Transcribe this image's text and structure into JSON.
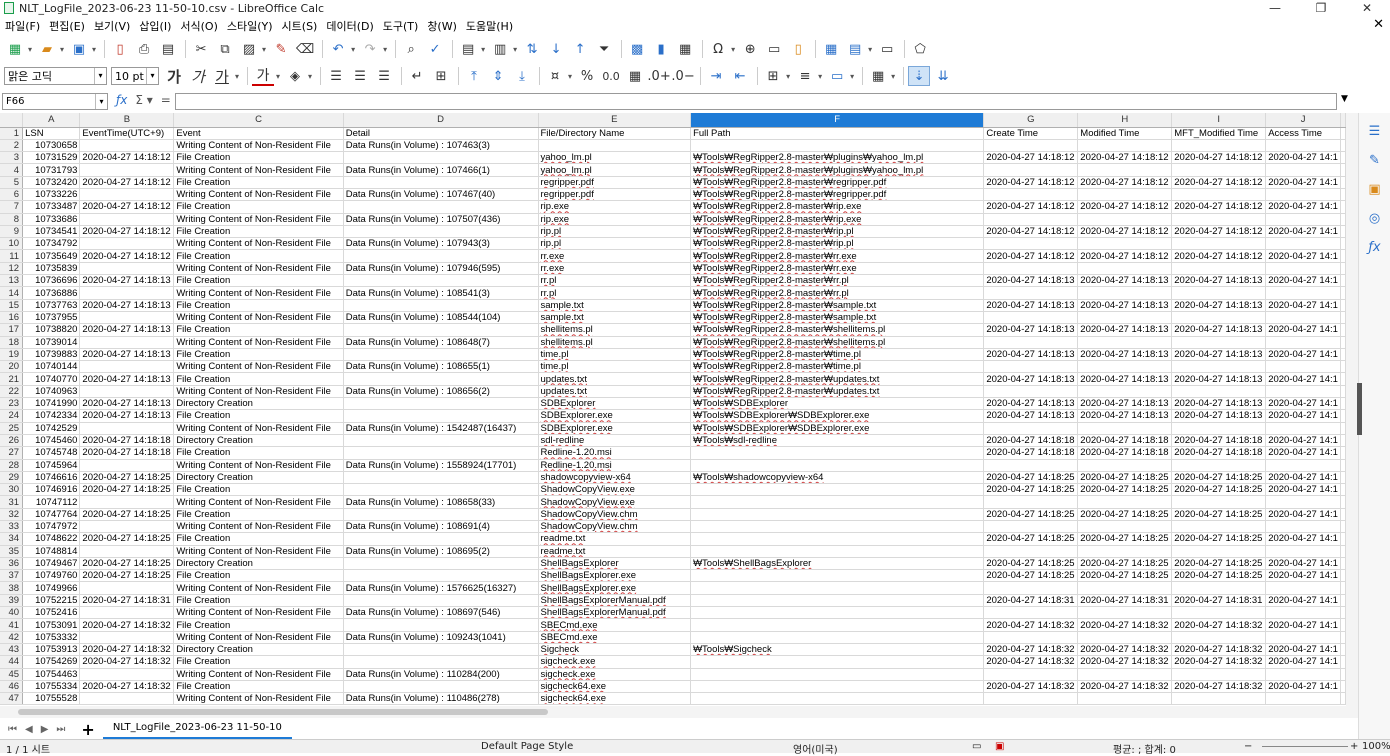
{
  "window": {
    "title": "NLT_LogFile_2023-06-23 11-50-10.csv - LibreOffice Calc",
    "buttons": [
      "—",
      "❐",
      "✕"
    ]
  },
  "menu": [
    "파일(F)",
    "편집(E)",
    "보기(V)",
    "삽입(I)",
    "서식(O)",
    "스타일(Y)",
    "시트(S)",
    "데이터(D)",
    "도구(T)",
    "창(W)",
    "도움말(H)"
  ],
  "format_bar": {
    "font_name": "맑은 고딕",
    "font_size": "10 pt",
    "bold_glyph": "가",
    "italic_glyph": "가",
    "underline_glyph": "가",
    "fontcolor_glyph": "가",
    "percent": "%",
    "number_format": "0.0"
  },
  "formula_bar": {
    "cell_ref": "F66",
    "content": ""
  },
  "columns": [
    "A",
    "B",
    "C",
    "D",
    "E",
    "F",
    "G",
    "H",
    "I",
    "J"
  ],
  "selected_column": "F",
  "header_row": [
    "LSN",
    "EventTime(UTC+9)",
    "Event",
    "Detail",
    "File/Directory Name",
    "Full Path",
    "Create Time",
    "Modified Time",
    "MFT_Modified Time",
    "Access Time"
  ],
  "rows": [
    [
      "10730658",
      "",
      "Writing Content of Non-Resident File",
      "Data Runs(in Volume) : 107463(3)",
      "",
      "",
      "",
      "",
      "",
      ""
    ],
    [
      "10731529",
      "2020-04-27 14:18:12",
      "File Creation",
      "",
      "yahoo_lm.pl",
      "₩Tools₩RegRipper2.8-master₩plugins₩yahoo_lm.pl",
      "2020-04-27 14:18:12",
      "2020-04-27 14:18:12",
      "2020-04-27 14:18:12",
      "2020-04-27 14:1"
    ],
    [
      "10731793",
      "",
      "Writing Content of Non-Resident File",
      "Data Runs(in Volume) : 107466(1)",
      "yahoo_lm.pl",
      "₩Tools₩RegRipper2.8-master₩plugins₩yahoo_lm.pl",
      "",
      "",
      "",
      ""
    ],
    [
      "10732420",
      "2020-04-27 14:18:12",
      "File Creation",
      "",
      "regripper.pdf",
      "₩Tools₩RegRipper2.8-master₩regripper.pdf",
      "2020-04-27 14:18:12",
      "2020-04-27 14:18:12",
      "2020-04-27 14:18:12",
      "2020-04-27 14:1"
    ],
    [
      "10733226",
      "",
      "Writing Content of Non-Resident File",
      "Data Runs(in Volume) : 107467(40)",
      "regripper.pdf",
      "₩Tools₩RegRipper2.8-master₩regripper.pdf",
      "",
      "",
      "",
      ""
    ],
    [
      "10733487",
      "2020-04-27 14:18:12",
      "File Creation",
      "",
      "rip.exe",
      "₩Tools₩RegRipper2.8-master₩rip.exe",
      "2020-04-27 14:18:12",
      "2020-04-27 14:18:12",
      "2020-04-27 14:18:12",
      "2020-04-27 14:1"
    ],
    [
      "10733686",
      "",
      "Writing Content of Non-Resident File",
      "Data Runs(in Volume) : 107507(436)",
      "rip.exe",
      "₩Tools₩RegRipper2.8-master₩rip.exe",
      "",
      "",
      "",
      ""
    ],
    [
      "10734541",
      "2020-04-27 14:18:12",
      "File Creation",
      "",
      "rip.pl",
      "₩Tools₩RegRipper2.8-master₩rip.pl",
      "2020-04-27 14:18:12",
      "2020-04-27 14:18:12",
      "2020-04-27 14:18:12",
      "2020-04-27 14:1"
    ],
    [
      "10734792",
      "",
      "Writing Content of Non-Resident File",
      "Data Runs(in Volume) : 107943(3)",
      "rip.pl",
      "₩Tools₩RegRipper2.8-master₩rip.pl",
      "",
      "",
      "",
      ""
    ],
    [
      "10735649",
      "2020-04-27 14:18:12",
      "File Creation",
      "",
      "rr.exe",
      "₩Tools₩RegRipper2.8-master₩rr.exe",
      "2020-04-27 14:18:12",
      "2020-04-27 14:18:12",
      "2020-04-27 14:18:12",
      "2020-04-27 14:1"
    ],
    [
      "10735839",
      "",
      "Writing Content of Non-Resident File",
      "Data Runs(in Volume) : 107946(595)",
      "rr.exe",
      "₩Tools₩RegRipper2.8-master₩rr.exe",
      "",
      "",
      "",
      ""
    ],
    [
      "10736696",
      "2020-04-27 14:18:13",
      "File Creation",
      "",
      "rr.pl",
      "₩Tools₩RegRipper2.8-master₩rr.pl",
      "2020-04-27 14:18:13",
      "2020-04-27 14:18:13",
      "2020-04-27 14:18:13",
      "2020-04-27 14:1"
    ],
    [
      "10736886",
      "",
      "Writing Content of Non-Resident File",
      "Data Runs(in Volume) : 108541(3)",
      "rr.pl",
      "₩Tools₩RegRipper2.8-master₩rr.pl",
      "",
      "",
      "",
      ""
    ],
    [
      "10737763",
      "2020-04-27 14:18:13",
      "File Creation",
      "",
      "sample.txt",
      "₩Tools₩RegRipper2.8-master₩sample.txt",
      "2020-04-27 14:18:13",
      "2020-04-27 14:18:13",
      "2020-04-27 14:18:13",
      "2020-04-27 14:1"
    ],
    [
      "10737955",
      "",
      "Writing Content of Non-Resident File",
      "Data Runs(in Volume) : 108544(104)",
      "sample.txt",
      "₩Tools₩RegRipper2.8-master₩sample.txt",
      "",
      "",
      "",
      ""
    ],
    [
      "10738820",
      "2020-04-27 14:18:13",
      "File Creation",
      "",
      "shellitems.pl",
      "₩Tools₩RegRipper2.8-master₩shellitems.pl",
      "2020-04-27 14:18:13",
      "2020-04-27 14:18:13",
      "2020-04-27 14:18:13",
      "2020-04-27 14:1"
    ],
    [
      "10739014",
      "",
      "Writing Content of Non-Resident File",
      "Data Runs(in Volume) : 108648(7)",
      "shellitems.pl",
      "₩Tools₩RegRipper2.8-master₩shellitems.pl",
      "",
      "",
      "",
      ""
    ],
    [
      "10739883",
      "2020-04-27 14:18:13",
      "File Creation",
      "",
      "time.pl",
      "₩Tools₩RegRipper2.8-master₩time.pl",
      "2020-04-27 14:18:13",
      "2020-04-27 14:18:13",
      "2020-04-27 14:18:13",
      "2020-04-27 14:1"
    ],
    [
      "10740144",
      "",
      "Writing Content of Non-Resident File",
      "Data Runs(in Volume) : 108655(1)",
      "time.pl",
      "₩Tools₩RegRipper2.8-master₩time.pl",
      "",
      "",
      "",
      ""
    ],
    [
      "10740770",
      "2020-04-27 14:18:13",
      "File Creation",
      "",
      "updates.txt",
      "₩Tools₩RegRipper2.8-master₩updates.txt",
      "2020-04-27 14:18:13",
      "2020-04-27 14:18:13",
      "2020-04-27 14:18:13",
      "2020-04-27 14:1"
    ],
    [
      "10740963",
      "",
      "Writing Content of Non-Resident File",
      "Data Runs(in Volume) : 108656(2)",
      "updates.txt",
      "₩Tools₩RegRipper2.8-master₩updates.txt",
      "",
      "",
      "",
      ""
    ],
    [
      "10741990",
      "2020-04-27 14:18:13",
      "Directory Creation",
      "",
      "SDBExplorer",
      "₩Tools₩SDBExplorer",
      "2020-04-27 14:18:13",
      "2020-04-27 14:18:13",
      "2020-04-27 14:18:13",
      "2020-04-27 14:1"
    ],
    [
      "10742334",
      "2020-04-27 14:18:13",
      "File Creation",
      "",
      "SDBExplorer.exe",
      "₩Tools₩SDBExplorer₩SDBExplorer.exe",
      "2020-04-27 14:18:13",
      "2020-04-27 14:18:13",
      "2020-04-27 14:18:13",
      "2020-04-27 14:1"
    ],
    [
      "10742529",
      "",
      "Writing Content of Non-Resident File",
      "Data Runs(in Volume) : 1542487(16437)",
      "SDBExplorer.exe",
      "₩Tools₩SDBExplorer₩SDBExplorer.exe",
      "",
      "",
      "",
      ""
    ],
    [
      "10745460",
      "2020-04-27 14:18:18",
      "Directory Creation",
      "",
      "sdl-redline",
      "₩Tools₩sdl-redline",
      "2020-04-27 14:18:18",
      "2020-04-27 14:18:18",
      "2020-04-27 14:18:18",
      "2020-04-27 14:1"
    ],
    [
      "10745748",
      "2020-04-27 14:18:18",
      "File Creation",
      "",
      "Redline-1.20.msi",
      "",
      "2020-04-27 14:18:18",
      "2020-04-27 14:18:18",
      "2020-04-27 14:18:18",
      "2020-04-27 14:1"
    ],
    [
      "10745964",
      "",
      "Writing Content of Non-Resident File",
      "Data Runs(in Volume) : 1558924(17701)",
      "Redline-1.20.msi",
      "",
      "",
      "",
      "",
      ""
    ],
    [
      "10746616",
      "2020-04-27 14:18:25",
      "Directory Creation",
      "",
      "shadowcopyview-x64",
      "₩Tools₩shadowcopyview-x64",
      "2020-04-27 14:18:25",
      "2020-04-27 14:18:25",
      "2020-04-27 14:18:25",
      "2020-04-27 14:1"
    ],
    [
      "10746916",
      "2020-04-27 14:18:25",
      "File Creation",
      "",
      "ShadowCopyView.exe",
      "",
      "2020-04-27 14:18:25",
      "2020-04-27 14:18:25",
      "2020-04-27 14:18:25",
      "2020-04-27 14:1"
    ],
    [
      "10747112",
      "",
      "Writing Content of Non-Resident File",
      "Data Runs(in Volume) : 108658(33)",
      "ShadowCopyView.exe",
      "",
      "",
      "",
      "",
      ""
    ],
    [
      "10747764",
      "2020-04-27 14:18:25",
      "File Creation",
      "",
      "ShadowCopyView.chm",
      "",
      "2020-04-27 14:18:25",
      "2020-04-27 14:18:25",
      "2020-04-27 14:18:25",
      "2020-04-27 14:1"
    ],
    [
      "10747972",
      "",
      "Writing Content of Non-Resident File",
      "Data Runs(in Volume) : 108691(4)",
      "ShadowCopyView.chm",
      "",
      "",
      "",
      "",
      ""
    ],
    [
      "10748622",
      "2020-04-27 14:18:25",
      "File Creation",
      "",
      "readme.txt",
      "",
      "2020-04-27 14:18:25",
      "2020-04-27 14:18:25",
      "2020-04-27 14:18:25",
      "2020-04-27 14:1"
    ],
    [
      "10748814",
      "",
      "Writing Content of Non-Resident File",
      "Data Runs(in Volume) : 108695(2)",
      "readme.txt",
      "",
      "",
      "",
      "",
      ""
    ],
    [
      "10749467",
      "2020-04-27 14:18:25",
      "Directory Creation",
      "",
      "ShellBagsExplorer",
      "₩Tools₩ShellBagsExplorer",
      "2020-04-27 14:18:25",
      "2020-04-27 14:18:25",
      "2020-04-27 14:18:25",
      "2020-04-27 14:1"
    ],
    [
      "10749760",
      "2020-04-27 14:18:25",
      "File Creation",
      "",
      "ShellBagsExplorer.exe",
      "",
      "2020-04-27 14:18:25",
      "2020-04-27 14:18:25",
      "2020-04-27 14:18:25",
      "2020-04-27 14:1"
    ],
    [
      "10749966",
      "",
      "Writing Content of Non-Resident File",
      "Data Runs(in Volume) : 1576625(16327)",
      "ShellBagsExplorer.exe",
      "",
      "",
      "",
      "",
      ""
    ],
    [
      "10752215",
      "2020-04-27 14:18:31",
      "File Creation",
      "",
      "ShellBagsExplorerManual.pdf",
      "",
      "2020-04-27 14:18:31",
      "2020-04-27 14:18:31",
      "2020-04-27 14:18:31",
      "2020-04-27 14:1"
    ],
    [
      "10752416",
      "",
      "Writing Content of Non-Resident File",
      "Data Runs(in Volume) : 108697(546)",
      "ShellBagsExplorerManual.pdf",
      "",
      "",
      "",
      "",
      ""
    ],
    [
      "10753091",
      "2020-04-27 14:18:32",
      "File Creation",
      "",
      "SBECmd.exe",
      "",
      "2020-04-27 14:18:32",
      "2020-04-27 14:18:32",
      "2020-04-27 14:18:32",
      "2020-04-27 14:1"
    ],
    [
      "10753332",
      "",
      "Writing Content of Non-Resident File",
      "Data Runs(in Volume) : 109243(1041)",
      "SBECmd.exe",
      "",
      "",
      "",
      "",
      ""
    ],
    [
      "10753913",
      "2020-04-27 14:18:32",
      "Directory Creation",
      "",
      "Sigcheck",
      "₩Tools₩Sigcheck",
      "2020-04-27 14:18:32",
      "2020-04-27 14:18:32",
      "2020-04-27 14:18:32",
      "2020-04-27 14:1"
    ],
    [
      "10754269",
      "2020-04-27 14:18:32",
      "File Creation",
      "",
      "sigcheck.exe",
      "",
      "2020-04-27 14:18:32",
      "2020-04-27 14:18:32",
      "2020-04-27 14:18:32",
      "2020-04-27 14:1"
    ],
    [
      "10754463",
      "",
      "Writing Content of Non-Resident File",
      "Data Runs(in Volume) : 110284(200)",
      "sigcheck.exe",
      "",
      "",
      "",
      "",
      ""
    ],
    [
      "10755334",
      "2020-04-27 14:18:32",
      "File Creation",
      "",
      "sigcheck64.exe",
      "",
      "2020-04-27 14:18:32",
      "2020-04-27 14:18:32",
      "2020-04-27 14:18:32",
      "2020-04-27 14:1"
    ],
    [
      "10755528",
      "",
      "Writing Content of Non-Resident File",
      "Data Runs(in Volume) : 110486(278)",
      "sigcheck64.exe",
      "",
      "",
      "",
      "",
      ""
    ]
  ],
  "sheet_tab": "NLT_LogFile_2023-06-23 11-50-10",
  "status": {
    "sheet_pos": "1 / 1 시트",
    "page_style": "Default Page Style",
    "language": "영어(미국)",
    "summary": "평균: ; 합계: 0",
    "zoom": "100%"
  },
  "colors": {
    "selected_column_header": "#1e7bd6",
    "accent_green": "#1a9d4b",
    "accent_blue": "#2a6fc9"
  }
}
